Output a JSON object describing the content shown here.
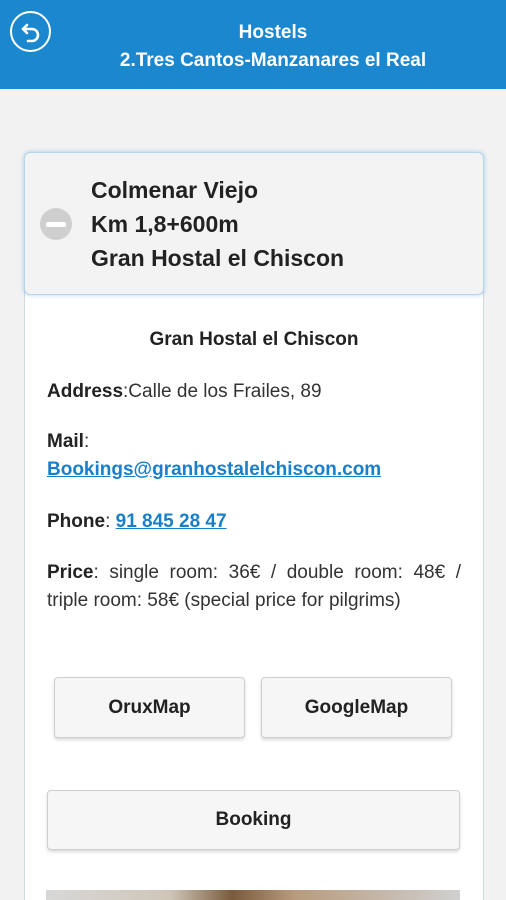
{
  "header": {
    "title_line1": "Hostels",
    "title_line2": "2.Tres Cantos-Manzanares el Real"
  },
  "collapsible": {
    "line1": "Colmenar Viejo",
    "line2": "Km 1,8+600m",
    "line3": "Gran Hostal el Chiscon"
  },
  "detail": {
    "name": "Gran Hostal el Chiscon",
    "address_label": "Address",
    "address_value": ":Calle de los Frailes, 89",
    "mail_label": "Mail",
    "mail_colon": ":",
    "mail_value": "Bookings@granhostalelchiscon.com",
    "phone_label": "Phone",
    "phone_colon": ": ",
    "phone_value": "91 845 28 47",
    "price_label": "Price",
    "price_value": ": single room: 36€ / double room: 48€ / triple room: 58€ (special price for pilgrims)"
  },
  "buttons": {
    "oruxmap": "OruxMap",
    "googlemap": "GoogleMap",
    "booking": "Booking"
  },
  "colors": {
    "header_bg": "#1b87cf",
    "link": "#1a7fc9"
  }
}
